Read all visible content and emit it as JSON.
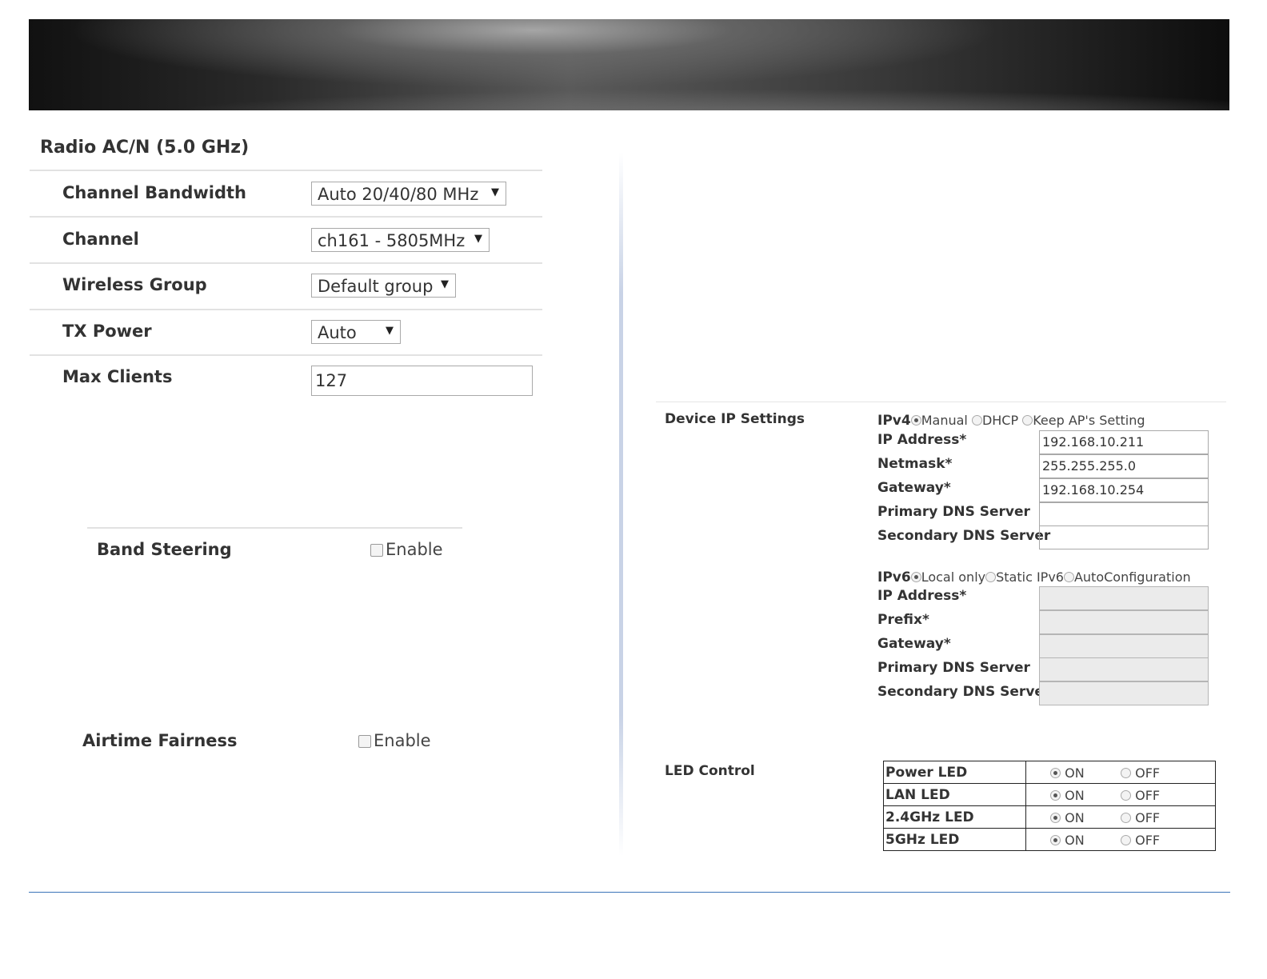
{
  "radio": {
    "title": "Radio AC/N (5.0 GHz)",
    "channel_bandwidth": {
      "label": "Channel Bandwidth",
      "value": "Auto 20/40/80 MHz"
    },
    "channel": {
      "label": "Channel",
      "value": "ch161 - 5805MHz"
    },
    "wireless_group": {
      "label": "Wireless Group",
      "value": "Default group"
    },
    "tx_power": {
      "label": "TX Power",
      "value": "Auto"
    },
    "max_clients": {
      "label": "Max Clients",
      "value": "127"
    }
  },
  "band_steering": {
    "label": "Band Steering",
    "checkbox_label": "Enable",
    "checked": false
  },
  "airtime_fairness": {
    "label": "Airtime Fairness",
    "checkbox_label": "Enable",
    "checked": false
  },
  "device_ip": {
    "section_label": "Device IP Settings",
    "ipv4": {
      "label": "IPv4",
      "modes": [
        "Manual",
        "DHCP",
        "Keep AP's Setting"
      ],
      "selected": "Manual",
      "fields": [
        {
          "label": "IP Address*",
          "value": "192.168.10.211"
        },
        {
          "label": "Netmask*",
          "value": "255.255.255.0"
        },
        {
          "label": "Gateway*",
          "value": "192.168.10.254"
        },
        {
          "label": "Primary DNS Server",
          "value": ""
        },
        {
          "label": "Secondary DNS Server",
          "value": ""
        }
      ]
    },
    "ipv6": {
      "label": "IPv6",
      "modes": [
        "Local only",
        "Static IPv6",
        "AutoConfiguration"
      ],
      "selected": "Local only",
      "fields": [
        {
          "label": "IP Address*",
          "value": ""
        },
        {
          "label": "Prefix*",
          "value": ""
        },
        {
          "label": "Gateway*",
          "value": ""
        },
        {
          "label": "Primary DNS Server",
          "value": ""
        },
        {
          "label": "Secondary DNS Server",
          "value": ""
        }
      ]
    }
  },
  "led_control": {
    "section_label": "LED Control",
    "on_label": "ON",
    "off_label": "OFF",
    "rows": [
      {
        "name": "Power LED",
        "state": "ON"
      },
      {
        "name": "LAN LED",
        "state": "ON"
      },
      {
        "name": "2.4GHz LED",
        "state": "ON"
      },
      {
        "name": "5GHz LED",
        "state": "ON"
      }
    ]
  },
  "colors": {
    "bottom_rule": "#3b74b8",
    "divider": "#c9d3e6"
  }
}
